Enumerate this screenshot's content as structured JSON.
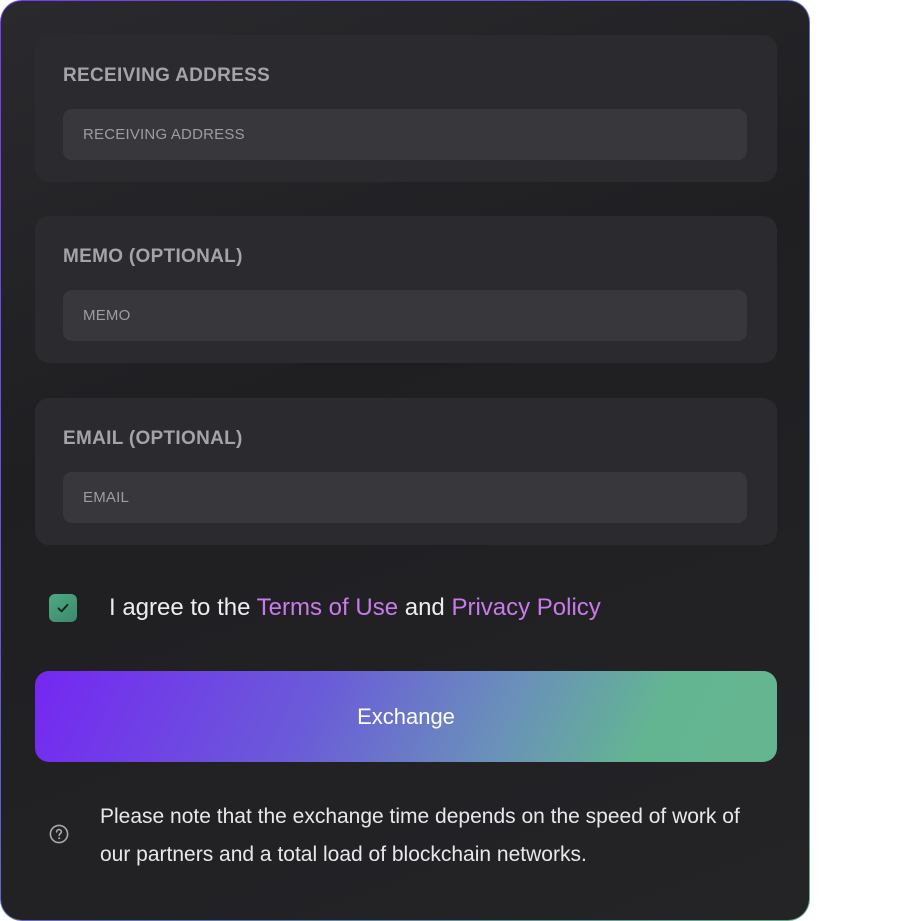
{
  "form": {
    "receiving_address": {
      "label": "RECEIVING ADDRESS",
      "placeholder": "RECEIVING ADDRESS"
    },
    "memo": {
      "label": "MEMO (OPTIONAL)",
      "placeholder": "MEMO"
    },
    "email": {
      "label": "EMAIL (OPTIONAL)",
      "placeholder": "EMAIL"
    }
  },
  "agreement": {
    "checked": true,
    "prefix": "I agree to the ",
    "terms_link": "Terms of Use",
    "middle": " and ",
    "privacy_link": "Privacy Policy",
    "check_icon": "check-icon",
    "link_color": "#c77be8"
  },
  "exchange_button": {
    "label": "Exchange"
  },
  "note": {
    "icon": "question-circle-icon",
    "text": "Please note that the exchange time depends on the speed of work of our partners and a total load of blockchain networks."
  },
  "colors": {
    "accent_purple": "#7527f2",
    "accent_green": "#64b58f",
    "card_background": "#1f1f22",
    "field_background": "#2b2b2f",
    "input_background": "#38383c"
  }
}
